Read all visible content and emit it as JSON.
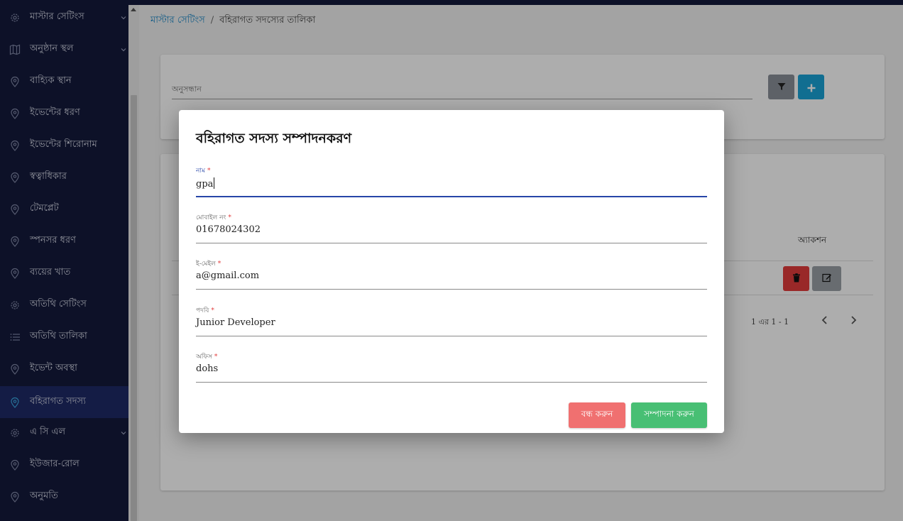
{
  "sidebar": {
    "items": [
      {
        "label": "মাস্টার সেটিংস",
        "icon": "gear-icon",
        "chevron": true
      },
      {
        "label": "অনুষ্ঠান স্থল",
        "icon": "map-icon",
        "chevron": true
      },
      {
        "label": "বাহ্যিক স্থান",
        "icon": "location-pin-icon",
        "chevron": false
      },
      {
        "label": "ইভেন্টের ধরণ",
        "icon": "location-pin-icon",
        "chevron": false
      },
      {
        "label": "ইভেন্টের শিরোনাম",
        "icon": "location-pin-icon",
        "chevron": false
      },
      {
        "label": "স্বত্বাধিকার",
        "icon": "location-pin-icon",
        "chevron": false
      },
      {
        "label": "টেমপ্লেট",
        "icon": "location-pin-icon",
        "chevron": false
      },
      {
        "label": "স্পনসর ধরণ",
        "icon": "location-pin-icon",
        "chevron": false
      },
      {
        "label": "ব্যয়ের খাত",
        "icon": "location-pin-icon",
        "chevron": false
      },
      {
        "label": "অতিথি সেটিংস",
        "icon": "gear-icon",
        "chevron": false
      },
      {
        "label": "অতিথি তালিকা",
        "icon": "list-icon",
        "chevron": false
      },
      {
        "label": "ইভেন্ট অবস্থা",
        "icon": "location-pin-icon",
        "chevron": false
      },
      {
        "label": "বহিরাগত সদস্য",
        "icon": "location-pin-icon",
        "chevron": false,
        "active": true
      },
      {
        "label": "এ সি এল",
        "icon": "gear-icon",
        "chevron": true
      },
      {
        "label": "ইউজার-রোল",
        "icon": "location-pin-icon",
        "chevron": false
      },
      {
        "label": "অনুমতি",
        "icon": "location-pin-icon",
        "chevron": false
      }
    ]
  },
  "breadcrumb": {
    "root": "মাস্টার সেটিংস",
    "separator": "/",
    "current": "বহিরাগত সদস্যের তালিকা"
  },
  "search": {
    "label": "অনুসন্ধান"
  },
  "table": {
    "action_header": "অ্যাকশন",
    "pagination": "1 এর 1 - 1"
  },
  "modal": {
    "title": "বহিরাগত সদস্য সম্পাদনকরণ",
    "fields": [
      {
        "label": "নাম",
        "value": "gpa",
        "required_mark": "*"
      },
      {
        "label": "মোবাইল নং",
        "value": "01678024302",
        "required_mark": "*"
      },
      {
        "label": "ই-মেইল",
        "value": "a@gmail.com",
        "required_mark": "*"
      },
      {
        "label": "পদবি",
        "value": "Junior Developer",
        "required_mark": "*"
      },
      {
        "label": "অফিস",
        "value": "dohs",
        "required_mark": "*"
      }
    ],
    "close_label": "বন্ধ করুন",
    "save_label": "সম্পাদনা করুন"
  },
  "colors": {
    "sidebar_bg": "#141a3c",
    "sidebar_active": "#1e2a66",
    "accent_blue": "#1aa3d6",
    "focus_blue": "#2746a8",
    "danger": "#e23c3c",
    "close_button": "#f07070",
    "save_button": "#48bf74"
  }
}
